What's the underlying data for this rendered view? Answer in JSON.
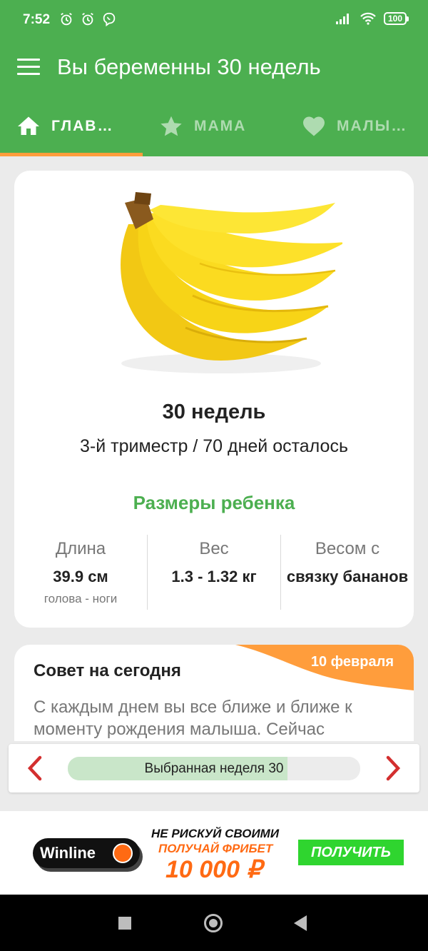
{
  "status_bar": {
    "time": "7:52",
    "battery": "100"
  },
  "app_bar": {
    "title": "Вы беременны 30 недель"
  },
  "tabs": [
    {
      "label": "ГЛАВ…",
      "icon": "home-icon",
      "active": true
    },
    {
      "label": "МАМА",
      "icon": "star-icon",
      "active": false
    },
    {
      "label": "МАЛЫ…",
      "icon": "heart-icon",
      "active": false
    }
  ],
  "main_card": {
    "fruit_image": "banana-bunch",
    "week_title": "30 недель",
    "subtitle": "3-й триместр / 70 дней осталось",
    "sizes_title": "Размеры ребенка",
    "metrics": [
      {
        "label": "Длина",
        "value": "39.9 см",
        "note": "голова - ноги"
      },
      {
        "label": "Вес",
        "value": "1.3 - 1.32 кг",
        "note": ""
      },
      {
        "label": "Весом с",
        "value": "связку бананов",
        "note": ""
      }
    ]
  },
  "tip": {
    "title": "Совет на сегодня",
    "date": "10 февраля",
    "text": "С каждым днем вы все ближе и ближе к моменту рождения малыша. Сейчас"
  },
  "week_nav": {
    "label": "Выбранная неделя 30",
    "progress_fraction": 0.75
  },
  "ad": {
    "brand": "Winline",
    "line1": "НЕ РИСКУЙ СВОИМИ",
    "line2": "ПОЛУЧАЙ ФРИБЕТ",
    "line3": "10 000 ₽",
    "button": "ПОЛУЧИТЬ"
  },
  "colors": {
    "primary": "#4caf50",
    "accent": "#ff9d3c",
    "nav_arrow": "#d32f2f"
  }
}
